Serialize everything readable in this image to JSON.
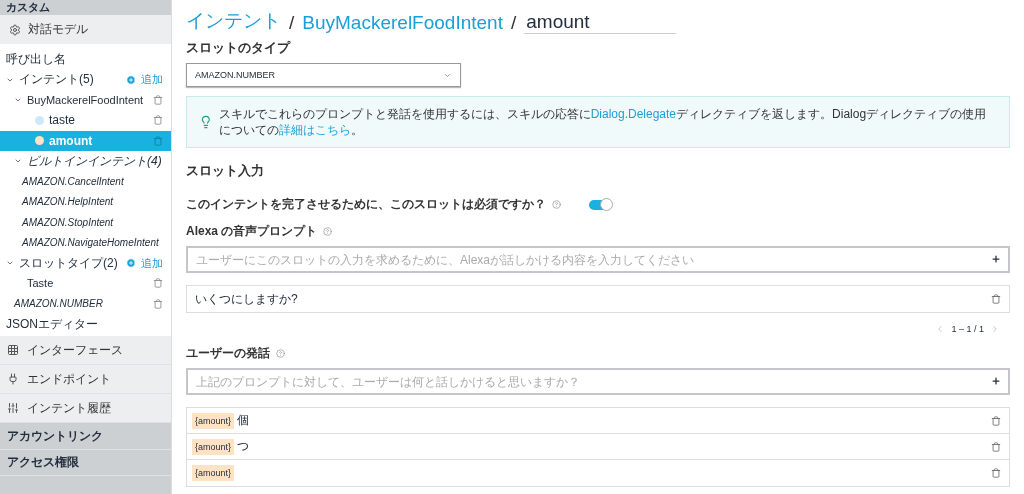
{
  "sidebar": {
    "header": "カスタム",
    "model": {
      "label": "対話モデル",
      "expanded": true
    },
    "tree": [
      {
        "label": "呼び出し名",
        "kind": "plain",
        "selected": false
      },
      {
        "label": "インテント(5)",
        "kind": "group",
        "expanded": true,
        "selected": false,
        "add_label": "追加",
        "children": [
          {
            "label": "BuyMackerelFoodIntent",
            "kind": "item",
            "expanded": true,
            "selected": false,
            "deletable": true,
            "children": [
              {
                "label": "taste",
                "kind": "slot",
                "color": "#cfe8f8",
                "selected": false,
                "deletable": true
              },
              {
                "label": "amount",
                "kind": "slot",
                "color": "#fde3c3",
                "selected": true,
                "deletable": true
              }
            ]
          },
          {
            "label": "ビルトインインテント(4)",
            "kind": "builtin-group",
            "expanded": true,
            "selected": false,
            "children": [
              {
                "label": "AMAZON.CancelIntent",
                "kind": "builtin",
                "selected": false
              },
              {
                "label": "AMAZON.HelpIntent",
                "kind": "builtin",
                "selected": false
              },
              {
                "label": "AMAZON.StopIntent",
                "kind": "builtin",
                "selected": false
              },
              {
                "label": "AMAZON.NavigateHomeIntent",
                "kind": "builtin",
                "selected": false
              }
            ]
          }
        ]
      },
      {
        "label": "スロットタイプ(2)",
        "kind": "group",
        "expanded": true,
        "selected": false,
        "add_label": "追加",
        "children": [
          {
            "label": "Taste",
            "kind": "item",
            "selected": false,
            "deletable": true
          },
          {
            "label": "AMAZON.NUMBER",
            "kind": "builtin",
            "selected": false,
            "deletable": true
          }
        ]
      },
      {
        "label": "JSONエディター",
        "kind": "plain",
        "selected": false
      }
    ],
    "nav": [
      {
        "label": "インターフェース",
        "kind": "tool"
      },
      {
        "label": "エンドポイント",
        "kind": "tool"
      },
      {
        "label": "インテント履歴",
        "kind": "tool"
      },
      {
        "label": "アカウントリンク",
        "kind": "group"
      },
      {
        "label": "アクセス権限",
        "kind": "group"
      }
    ]
  },
  "breadcrumb": [
    {
      "label": "インテント",
      "separator": "/"
    },
    {
      "label": "BuyMackerelFoodIntent",
      "separator": "/"
    }
  ],
  "slot_name": {
    "value": "amount"
  },
  "slot_type": {
    "label": "スロットのタイプ",
    "value": "AMAZON.NUMBER"
  },
  "info": {
    "parts": [
      {
        "kind": "text",
        "text": "スキルでこれらのプロンプトと発話を使用するには、スキルの応答に"
      },
      {
        "kind": "link",
        "text": "Dialog.Delegate"
      },
      {
        "kind": "text",
        "text": "ディレクティブを返します。Dialogディレクティブの使用についての"
      },
      {
        "kind": "link",
        "text": "詳細はこちら"
      },
      {
        "kind": "text",
        "text": "。"
      }
    ]
  },
  "slot_input": {
    "title": "スロット入力",
    "required": {
      "label": "このインテントを完了させるために、このスロットは必須ですか？",
      "on": true
    },
    "prompts": {
      "label": "Alexa の音声プロンプト",
      "placeholder": "ユーザーにこのスロットの入力を求めるために、Alexaが話しかける内容を入力してください",
      "items": [
        "いくつにしますか?"
      ],
      "pager": "1 – 1 / 1"
    },
    "utterances": {
      "label": "ユーザーの発話",
      "placeholder": "上記のプロンプトに対して、ユーザーは何と話しかけると思いますか？",
      "items": [
        {
          "slot": "{amount}",
          "text": "個"
        },
        {
          "slot": "{amount}",
          "text": "つ"
        },
        {
          "slot": "{amount}"
        }
      ]
    }
  }
}
